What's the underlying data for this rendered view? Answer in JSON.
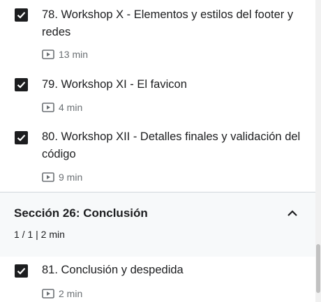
{
  "lectures": [
    {
      "title": "78. Workshop X - Elementos y estilos del footer y redes",
      "duration": "13 min"
    },
    {
      "title": "79. Workshop XI - El favicon",
      "duration": "4 min"
    },
    {
      "title": "80. Workshop XII - Detalles finales y validación del código",
      "duration": "9 min"
    }
  ],
  "section": {
    "title": "Sección 26: Conclusión",
    "summary": "1 / 1 | 2 min"
  },
  "section_lectures": [
    {
      "title": "81. Conclusión y despedida",
      "duration": "2 min"
    }
  ]
}
